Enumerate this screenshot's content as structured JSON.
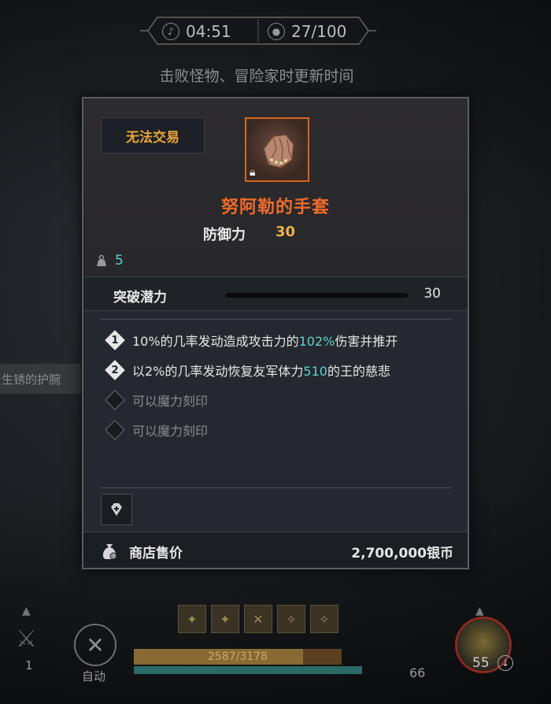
{
  "hud_top": {
    "timer": "04:51",
    "count": "27/100",
    "subtitle": "击败怪物、冒险家时更新时间",
    "timer_icon": "music-note-icon",
    "count_icon": "person-icon"
  },
  "background": {
    "side_item_label": "生锈的护腕"
  },
  "tooltip": {
    "trade_badge": "无法交易",
    "item_icon": "gauntlet-icon",
    "item_name": "努阿勒的手套",
    "stat_label": "防御力",
    "stat_value": "30",
    "weight_value": "5",
    "potential_label": "突破潜力",
    "potential_value": "30",
    "effects": [
      {
        "num": "1",
        "pre": "10%的几率发动造成攻击力的",
        "hl": "102%",
        "post": "伤害并推开"
      },
      {
        "num": "2",
        "pre": "以2%的几率发动恢复友军体力",
        "hl": "510",
        "post": "的王的慈悲"
      },
      {
        "num": "",
        "text": "可以魔力刻印"
      },
      {
        "num": "",
        "text": "可以魔力刻印"
      }
    ],
    "price_label": "商店售价",
    "price_value": "2,700,000银币"
  },
  "hud_bottom": {
    "left_count": "1",
    "auto_label": "自动",
    "hp_text": "2587/3178",
    "hp_fraction": 0.814,
    "mp_fraction": 1.0,
    "level": "66",
    "potion_count": "55"
  },
  "colors": {
    "item_name": "#ef6b2a",
    "stat_value": "#e9b24a",
    "highlight": "#5fd0d0",
    "trade_badge": "#e8a33a"
  }
}
